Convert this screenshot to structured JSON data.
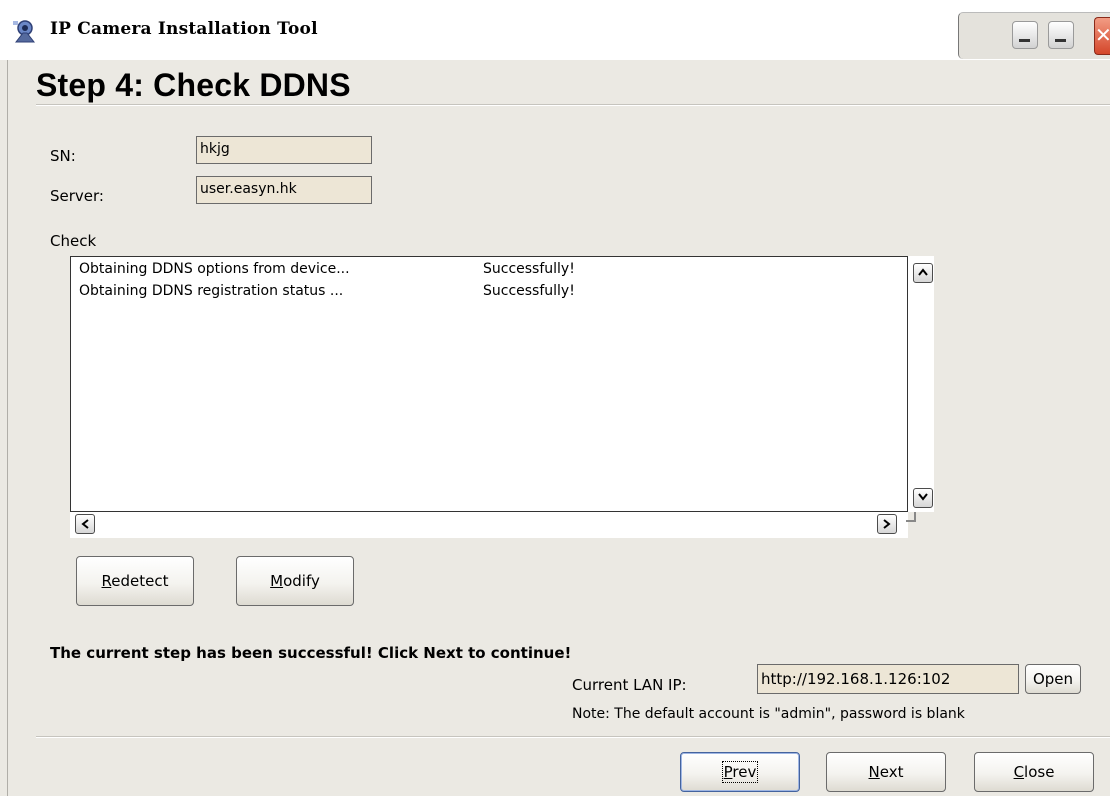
{
  "window": {
    "title": "IP Camera Installation Tool"
  },
  "step": {
    "title": "Step 4: Check DDNS"
  },
  "fields": {
    "sn_label": "SN:",
    "sn_value": "hkjg",
    "server_label": "Server:",
    "server_value": "user.easyn.hk"
  },
  "check": {
    "label": "Check",
    "rows": [
      {
        "task": "Obtaining DDNS options from device...",
        "result": "Successfully!"
      },
      {
        "task": "Obtaining DDNS registration status ...",
        "result": "Successfully!"
      }
    ]
  },
  "actions": {
    "redetect_mnemonic": "R",
    "redetect_rest": "edetect",
    "modify_mnemonic": "M",
    "modify_rest": "odify"
  },
  "status": {
    "message": "The current step has been successful! Click Next to continue!"
  },
  "lan": {
    "label": "Current LAN IP:",
    "value": "http://192.168.1.126:102",
    "open_label": "Open",
    "note": "Note: The default account is \"admin\", password is blank"
  },
  "nav": {
    "prev_mnemonic": "P",
    "prev_rest": "rev",
    "next_mnemonic": "N",
    "next_rest": "ext",
    "close_mnemonic": "C",
    "close_rest": "lose"
  },
  "icons": {
    "app": "camera-icon",
    "minimize": "minimize-icon",
    "close": "close-icon",
    "scroll_up": "chevron-up-icon",
    "scroll_down": "chevron-down-icon",
    "scroll_left": "chevron-left-icon",
    "scroll_right": "chevron-right-icon"
  }
}
